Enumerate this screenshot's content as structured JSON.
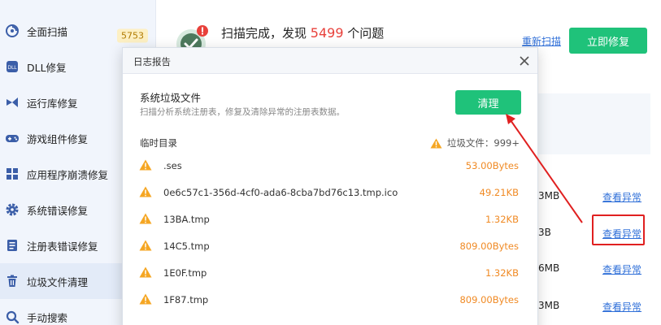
{
  "sidebar": {
    "items": [
      {
        "label": "全面扫描",
        "icon": "scan-icon",
        "badge": "5753"
      },
      {
        "label": "DLL修复",
        "icon": "dll-icon"
      },
      {
        "label": "运行库修复",
        "icon": "runtime-icon"
      },
      {
        "label": "游戏组件修复",
        "icon": "gamepad-icon"
      },
      {
        "label": "应用程序崩溃修复",
        "icon": "apps-grid-icon"
      },
      {
        "label": "系统错误修复",
        "icon": "gear-icon"
      },
      {
        "label": "注册表错误修复",
        "icon": "registry-icon"
      },
      {
        "label": "垃圾文件清理",
        "icon": "trash-icon",
        "active": true
      },
      {
        "label": "手动搜索",
        "icon": "search-icon"
      }
    ]
  },
  "header": {
    "result_prefix": "扫描完成，发现 ",
    "result_count": "5499",
    "result_suffix": " 个问题",
    "rescan_label": "重新扫描",
    "repair_label": "立即修复"
  },
  "background_rows": [
    {
      "size": "3MB",
      "link": "查看异常"
    },
    {
      "size": "3B",
      "link": "查看异常"
    },
    {
      "size": "6MB",
      "link": "查看异常"
    },
    {
      "size": "3MB",
      "link": "查看异常"
    }
  ],
  "dialog": {
    "title": "日志报告",
    "section_title": "系统垃圾文件",
    "section_desc": "扫描分析系统注册表，修复及清除异常的注册表数据。",
    "clean_label": "清理",
    "dir_label": "临时目录",
    "junk_info": "垃圾文件：999+",
    "files": [
      {
        "name": ".ses",
        "size": "53.00Bytes"
      },
      {
        "name": "0e6c57c1-356d-4cf0-ada6-8cba7bd76c13.tmp.ico",
        "size": "49.21KB"
      },
      {
        "name": "13BA.tmp",
        "size": "1.32KB"
      },
      {
        "name": "14C5.tmp",
        "size": "809.00Bytes"
      },
      {
        "name": "1E0F.tmp",
        "size": "1.32KB"
      },
      {
        "name": "1F87.tmp",
        "size": "809.00Bytes"
      }
    ]
  },
  "colors": {
    "accent_green": "#1fc27a",
    "warning_orange": "#f08a24",
    "link_blue": "#2f6fd8",
    "alert_red": "#e02020"
  }
}
